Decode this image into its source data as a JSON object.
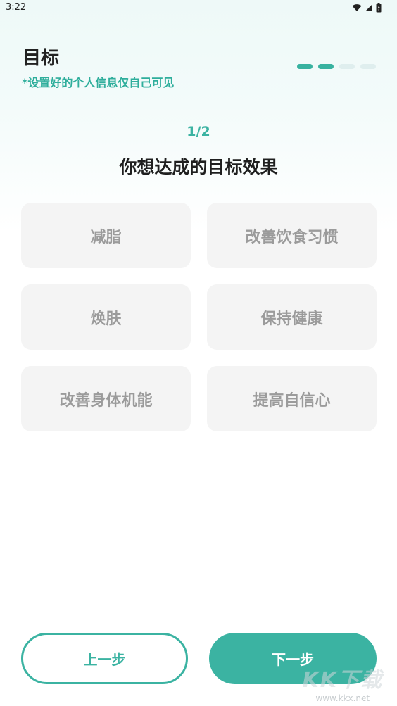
{
  "status_bar": {
    "time": "3:22"
  },
  "header": {
    "title": "目标",
    "subtitle": "*设置好的个人信息仅自己可见",
    "progress": {
      "total_steps": 4,
      "completed_steps": 2
    }
  },
  "question": {
    "step": "1/2",
    "prompt": "你想达成的目标效果",
    "options": [
      "减脂",
      "改善饮食习惯",
      "焕肤",
      "保持健康",
      "改善身体机能",
      "提高自信心"
    ]
  },
  "buttons": {
    "prev_label": "上一步",
    "next_label": "下一步"
  },
  "watermark": {
    "logo": "KK下载",
    "url": "www.kkx.net"
  },
  "colors": {
    "accent": "#3bb3a2",
    "option_bg": "#f4f4f4",
    "option_text": "#9b9b9b"
  }
}
